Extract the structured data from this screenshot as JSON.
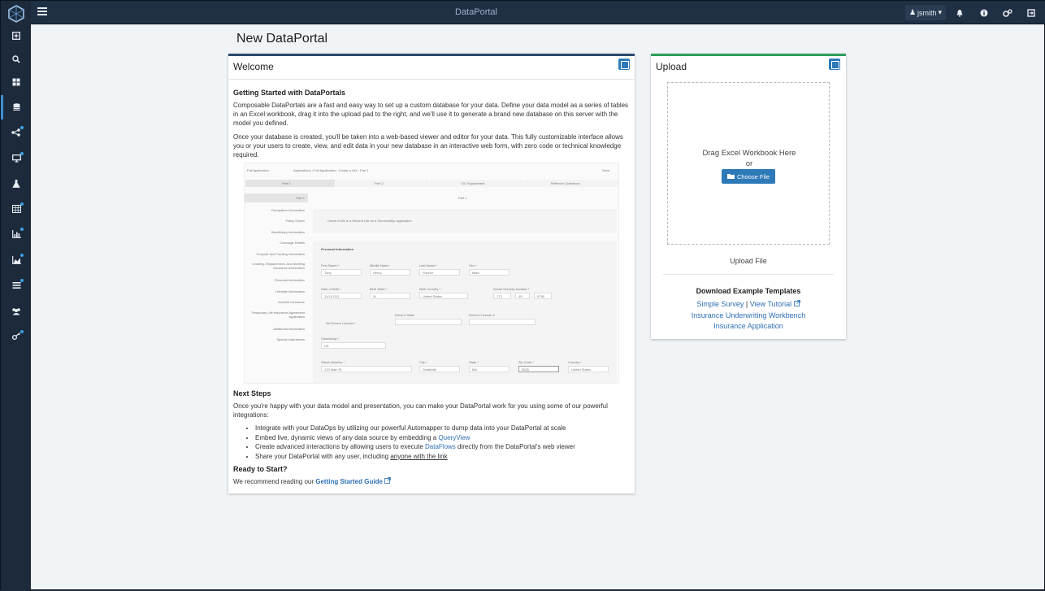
{
  "topbar": {
    "title": "DataPortal",
    "username": "jsmith"
  },
  "page": {
    "title": "New DataPortal"
  },
  "welcome": {
    "title": "Welcome",
    "getting_started_heading": "Getting Started with DataPortals",
    "para1": "Composable DataPortals are a fast and easy way to set up a custom database for your data. Define your data model as a series of tables in an Excel workbook, drag it into the upload pad to the right, and we'll use it to generate a brand new database on this server with the model you defined.",
    "para2": "Once your database is created, you'll be taken into a web-based viewer and editor for your data. This fully customizable interface allows you or your users to create, view, and edit data in your new database in an interactive web form, with zero code or technical knowledge required.",
    "next_steps_heading": "Next Steps",
    "next_steps_text": "Once you're happy with your data model and presentation, you can make your DataPortal work for you using some of our powerful integrations:",
    "bullets": {
      "b1": "Integrate with your DataOps by utilizing our powerful Automapper to dump data into your DataPortal at scale",
      "b2_pre": "Embed live, dynamic views of any data source by embedding a ",
      "b2_link": "QueryView",
      "b3_pre": "Create advanced interactions by allowing users to execute ",
      "b3_link": "DataFlows",
      "b3_post": " directly from the DataPortal's web viewer",
      "b4_pre": "Share your DataPortal with any user, including ",
      "b4_link": "anyone with the link"
    },
    "ready_heading": "Ready to Start?",
    "ready_pre": "We recommend reading our ",
    "ready_link": "Getting Started Guide"
  },
  "form_preview": {
    "breadcrumb_home": "Full Application",
    "breadcrumb_path": "Applications  ›  Full Application  ›  Create a Life  ›  Part 1",
    "save_label": "Save",
    "tabs": [
      "Part 1",
      "Part 2",
      "CIC Supplement",
      "Reflexive Questions"
    ],
    "section_title": "Part 1",
    "sidebar": [
      "Part 1",
      "Occupation Information",
      "Policy Owner",
      "Beneficiary Information",
      "Coverage Details",
      "Purpose and Funding Information",
      "Lending, Replacement, And Meeting Insurance Information",
      "Personal Information",
      "Lifestyle Information",
      "Juvenile Insurance",
      "Temporary Life Insurance Agreement Application",
      "Additional Information",
      "Special Instructions"
    ],
    "second_life_check": "Check if this is a Second Life on a Survivorship application",
    "personal_info": "Personal Information",
    "fields": {
      "first_name": "First Name *",
      "first_name_val": "Tony",
      "middle_name": "Middle Name",
      "middle_name_val": "Henry",
      "last_name": "Last Name *",
      "last_name_val": "Fischer",
      "sex": "Sex *",
      "sex_val": "Male",
      "dob": "Date of Birth *",
      "dob_val": "11/11/1111",
      "birth_state": "Birth State *",
      "birth_state_val": "IA",
      "birth_country": "Birth Country *",
      "birth_country_val": "United States",
      "ssn": "Social Security Number *",
      "ssn_1": "173",
      "ssn_2": "49",
      "ssn_3": "6795",
      "no_license": "No Drivers License *",
      "license_state": "Driver's State",
      "license_no": "Driver's License #",
      "citizenship": "Citizenship *",
      "citizenship_val": "US",
      "street": "Street Address *",
      "street_val": "123 Main St",
      "city": "City *",
      "city_val": "Smallville",
      "state": "State *",
      "state_val": "MA",
      "zip": "Zip Code *",
      "zip_val": "5555",
      "country": "Country *",
      "country_val": "United States"
    }
  },
  "upload": {
    "title": "Upload",
    "drag_line1": "Drag Excel Workbook Here",
    "drag_line2": "or",
    "choose_file": "Choose File",
    "upload_file": "Upload File",
    "templates_heading": "Download Example Templates",
    "simple_survey": "Simple Survey",
    "separator": "|",
    "view_tutorial": "View Tutorial",
    "template2": "Insurance Underwriting Workbench",
    "template3": "Insurance Application"
  },
  "colors": {
    "accent": "#2e7ab8",
    "topbar": "#1f2f44",
    "sidebar": "#1c2a3b",
    "welcome_border": "#2c4a6e",
    "upload_border": "#2e9e5b"
  }
}
